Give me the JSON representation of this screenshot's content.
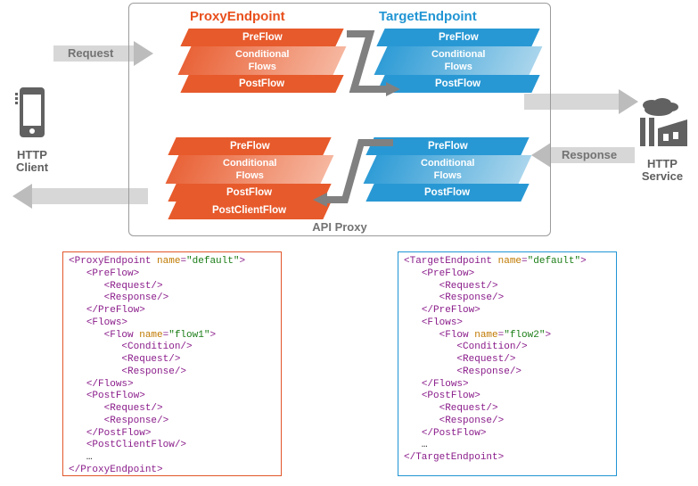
{
  "client": {
    "label": "HTTP\nClient"
  },
  "service": {
    "label": "HTTP\nService"
  },
  "labels": {
    "request": "Request",
    "response": "Response",
    "apiProxy": "API Proxy"
  },
  "columns": {
    "proxyEndpoint": "ProxyEndpoint",
    "targetEndpoint": "TargetEndpoint"
  },
  "flowLabels": {
    "preFlow": "PreFlow",
    "conditionalFlows": "Conditional\nFlows",
    "postFlow": "PostFlow",
    "postClientFlow": "PostClientFlow"
  },
  "proxySlabTopRequest": [
    "PreFlow",
    "Conditional\nFlows",
    "PostFlow"
  ],
  "targetSlabTopRequest": [
    "PreFlow",
    "Conditional\nFlows",
    "PostFlow"
  ],
  "targetSlabBottomResponse": [
    "PreFlow",
    "Conditional\nFlows",
    "PostFlow"
  ],
  "proxySlabBottomResponse": [
    "PreFlow",
    "Conditional\nFlows",
    "PostFlow",
    "PostClientFlow"
  ],
  "codeProxy": {
    "root": "ProxyEndpoint",
    "rootAttrName": "name",
    "rootAttrVal": "default",
    "flowName": "flow1",
    "hasPostClient": true
  },
  "codeTarget": {
    "root": "TargetEndpoint",
    "rootAttrName": "name",
    "rootAttrVal": "default",
    "flowName": "flow2",
    "hasPostClient": false
  }
}
